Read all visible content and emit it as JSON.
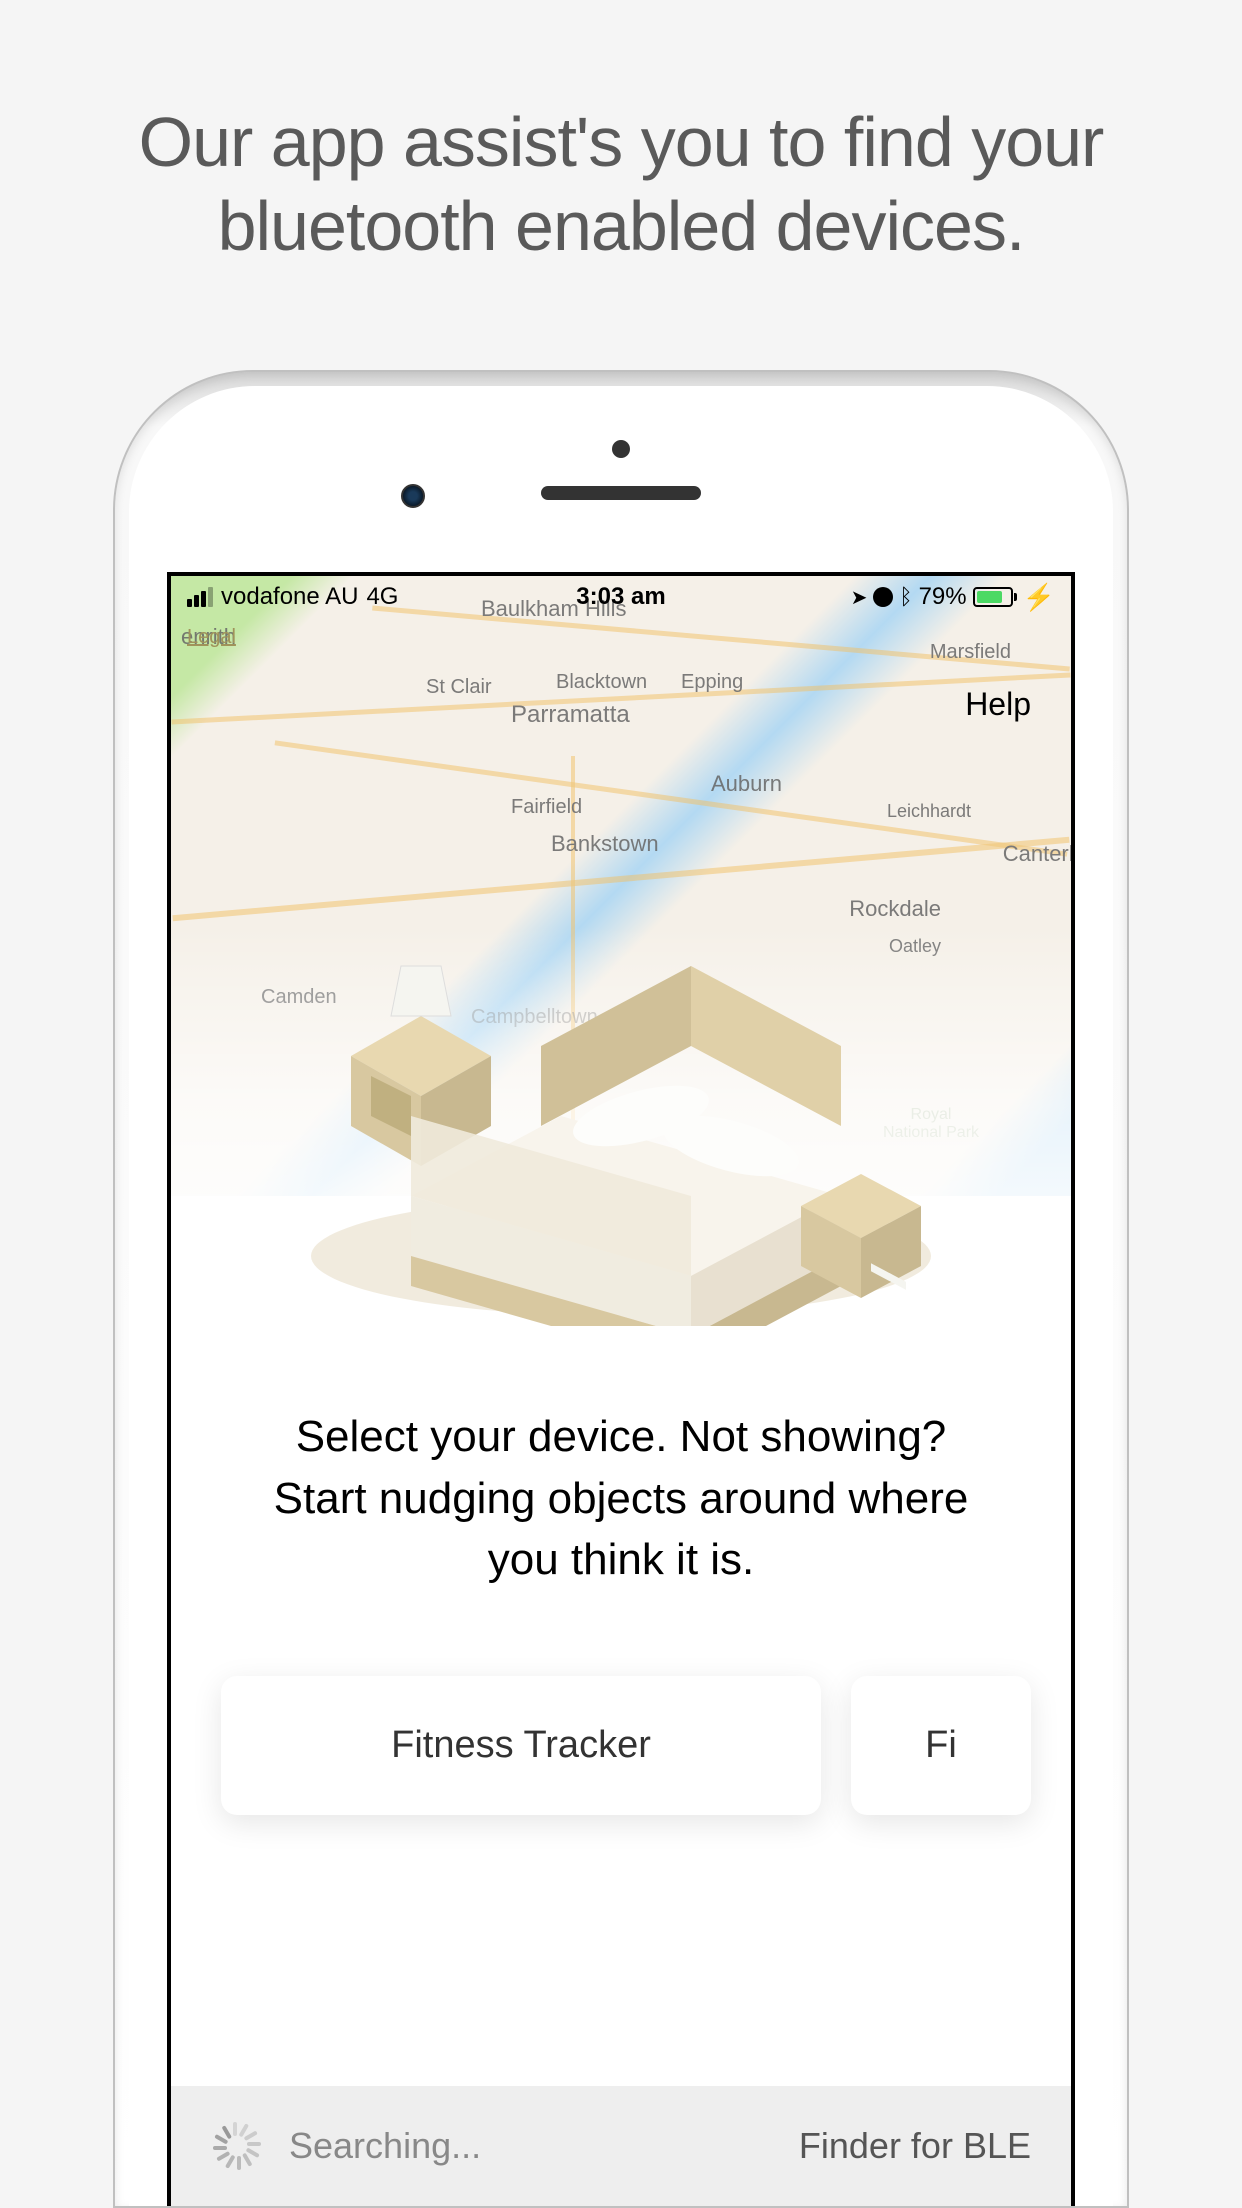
{
  "promo": {
    "headline": "Our app assist's you to find your bluetooth enabled devices."
  },
  "status_bar": {
    "carrier": "vodafone AU",
    "network": "4G",
    "time": "3:03 am",
    "battery_percent": "79%"
  },
  "map": {
    "legal_label": "Legal",
    "help_label": "Help",
    "labels": [
      "Baulkham Hills",
      "St Clair",
      "Blacktown",
      "Epping",
      "Marsfield",
      "Parramatta",
      "Fairfield",
      "Auburn",
      "Leichhardt",
      "Bankstown",
      "Canterb",
      "Rockdale",
      "Oatley",
      "Camden",
      "Campbelltown",
      "Royal National Park",
      "enrith"
    ]
  },
  "instruction": "Select your device. Not showing? Start nudging objects around where you think it is.",
  "devices": [
    {
      "name": "Fitness Tracker"
    },
    {
      "name": "Fi"
    }
  ],
  "bottom_bar": {
    "searching": "Searching...",
    "app_name": "Finder for BLE"
  }
}
